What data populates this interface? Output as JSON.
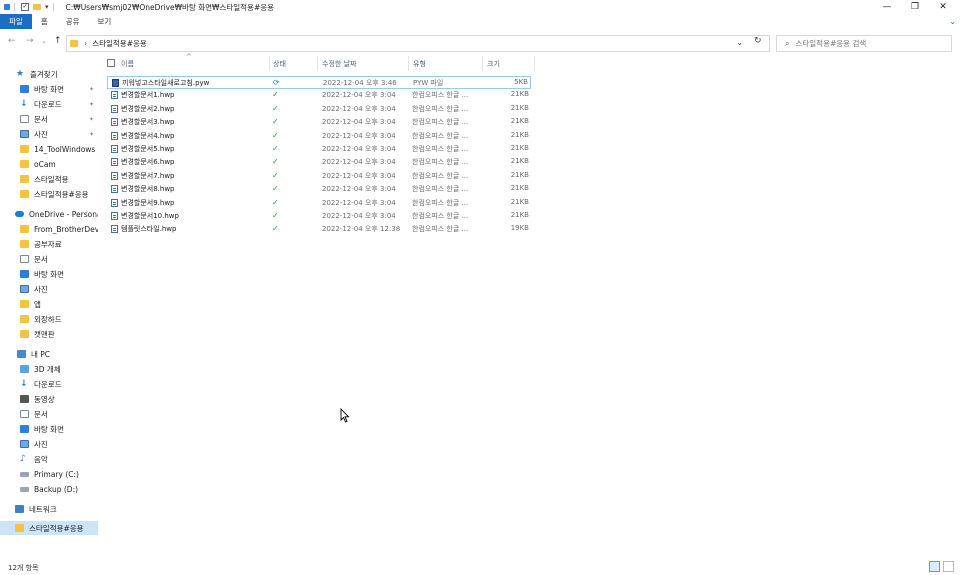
{
  "window": {
    "title": "C:₩Users₩smj02₩OneDrive₩바탕 화면₩스타일적용#응용",
    "minimize_glyph": "—",
    "maximize_glyph": "❐",
    "close_glyph": "✕"
  },
  "ribbon": {
    "tabs": [
      "파일",
      "홈",
      "공유",
      "보기"
    ],
    "active_tab": "파일",
    "expand_glyph": "⌄"
  },
  "address": {
    "back_glyph": "←",
    "forward_glyph": "→",
    "recent_glyph": "⌄",
    "up_glyph": "↑",
    "path_text": "스타일적용#응용",
    "dropdown_glyph": "⌄",
    "refresh_glyph": "↻"
  },
  "search": {
    "placeholder": "스타일적용#응용 검색",
    "icon_glyph": "⌕"
  },
  "sidebar": {
    "items": [
      {
        "label": "즐겨찾기",
        "icon": "star-icon",
        "pinned": false
      },
      {
        "label": "바탕 화면",
        "icon": "desktop-icon",
        "pinned": true
      },
      {
        "label": "다운로드",
        "icon": "download-icon",
        "pinned": true
      },
      {
        "label": "문서",
        "icon": "document-icon",
        "pinned": true
      },
      {
        "label": "사진",
        "icon": "picture-icon",
        "pinned": true
      },
      {
        "label": "14_ToolWindows",
        "icon": "folder-icon",
        "pinned": false
      },
      {
        "label": "oCam",
        "icon": "folder-icon",
        "pinned": false
      },
      {
        "label": "스타일적용",
        "icon": "folder-icon",
        "pinned": false
      },
      {
        "label": "스타일적용#응용",
        "icon": "folder-icon",
        "pinned": false
      },
      {
        "label": "OneDrive - Personal",
        "icon": "cloud-icon",
        "pinned": false
      },
      {
        "label": "From_BrotherDevice",
        "icon": "folder-icon",
        "pinned": false
      },
      {
        "label": "공부자료",
        "icon": "folder-icon",
        "pinned": false
      },
      {
        "label": "문서",
        "icon": "document-icon",
        "pinned": false
      },
      {
        "label": "바탕 화면",
        "icon": "desktop-icon",
        "pinned": false
      },
      {
        "label": "사진",
        "icon": "picture-icon",
        "pinned": false
      },
      {
        "label": "앱",
        "icon": "folder-icon",
        "pinned": false
      },
      {
        "label": "외장하드",
        "icon": "folder-icon",
        "pinned": false
      },
      {
        "label": "캣맨판",
        "icon": "folder-icon",
        "pinned": false
      },
      {
        "label": "내 PC",
        "icon": "pc-icon",
        "pinned": false
      },
      {
        "label": "3D 개체",
        "icon": "cube-icon",
        "pinned": false
      },
      {
        "label": "다운로드",
        "icon": "download-icon",
        "pinned": false
      },
      {
        "label": "동영상",
        "icon": "video-icon",
        "pinned": false
      },
      {
        "label": "문서",
        "icon": "document-icon",
        "pinned": false
      },
      {
        "label": "바탕 화면",
        "icon": "desktop-icon",
        "pinned": false
      },
      {
        "label": "사진",
        "icon": "picture-icon",
        "pinned": false
      },
      {
        "label": "음악",
        "icon": "music-icon",
        "pinned": false
      },
      {
        "label": "Primary (C:)",
        "icon": "drive-icon",
        "pinned": false
      },
      {
        "label": "Backup (D:)",
        "icon": "drive-icon",
        "pinned": false
      },
      {
        "label": "네트워크",
        "icon": "network-icon",
        "pinned": false
      },
      {
        "label": "스타일적용#응용",
        "icon": "folder-icon",
        "pinned": false,
        "selected": true
      }
    ],
    "pin_glyph": "📌"
  },
  "columns": {
    "name": "이름",
    "status": "상태",
    "modified": "수정한 날짜",
    "type": "유형",
    "size": "크기",
    "sort_glyph": "^"
  },
  "files": [
    {
      "name": "끼워넣고스타일새로고침.pyw",
      "status": "sync",
      "modified": "2022-12-04 오후 3:46",
      "type": "PYW 파일",
      "size": "5KB",
      "icon": "python-file-icon"
    },
    {
      "name": "변경할문서1.hwp",
      "status": "ok",
      "modified": "2022-12-04 오후 3:04",
      "type": "한컴오피스 한글 ...",
      "size": "21KB",
      "icon": "hwp-file-icon"
    },
    {
      "name": "변경할문서2.hwp",
      "status": "ok",
      "modified": "2022-12-04 오후 3:04",
      "type": "한컴오피스 한글 ...",
      "size": "21KB",
      "icon": "hwp-file-icon"
    },
    {
      "name": "변경할문서3.hwp",
      "status": "ok",
      "modified": "2022-12-04 오후 3:04",
      "type": "한컴오피스 한글 ...",
      "size": "21KB",
      "icon": "hwp-file-icon"
    },
    {
      "name": "변경할문서4.hwp",
      "status": "ok",
      "modified": "2022-12-04 오후 3:04",
      "type": "한컴오피스 한글 ...",
      "size": "21KB",
      "icon": "hwp-file-icon"
    },
    {
      "name": "변경할문서5.hwp",
      "status": "ok",
      "modified": "2022-12-04 오후 3:04",
      "type": "한컴오피스 한글 ...",
      "size": "21KB",
      "icon": "hwp-file-icon"
    },
    {
      "name": "변경할문서6.hwp",
      "status": "ok",
      "modified": "2022-12-04 오후 3:04",
      "type": "한컴오피스 한글 ...",
      "size": "21KB",
      "icon": "hwp-file-icon"
    },
    {
      "name": "변경할문서7.hwp",
      "status": "ok",
      "modified": "2022-12-04 오후 3:04",
      "type": "한컴오피스 한글 ...",
      "size": "21KB",
      "icon": "hwp-file-icon"
    },
    {
      "name": "변경할문서8.hwp",
      "status": "ok",
      "modified": "2022-12-04 오후 3:04",
      "type": "한컴오피스 한글 ...",
      "size": "21KB",
      "icon": "hwp-file-icon"
    },
    {
      "name": "변경할문서9.hwp",
      "status": "ok",
      "modified": "2022-12-04 오후 3:04",
      "type": "한컴오피스 한글 ...",
      "size": "21KB",
      "icon": "hwp-file-icon"
    },
    {
      "name": "변경할문서10.hwp",
      "status": "ok",
      "modified": "2022-12-04 오후 3:04",
      "type": "한컴오피스 한글 ...",
      "size": "21KB",
      "icon": "hwp-file-icon"
    },
    {
      "name": "템플릿스타일.hwp",
      "status": "ok",
      "modified": "2022-12-04 오후 12:38",
      "type": "한컴오피스 한글 ...",
      "size": "19KB",
      "icon": "hwp-file-icon"
    }
  ],
  "status_glyphs": {
    "ok": "✓",
    "sync": "⟳"
  },
  "statusbar": {
    "item_count": "12개 항목"
  },
  "colors": {
    "accent": "#1a6fc4",
    "selection": "#cce4f7",
    "folder": "#f5c344",
    "status_ok": "#2e9e3e"
  }
}
